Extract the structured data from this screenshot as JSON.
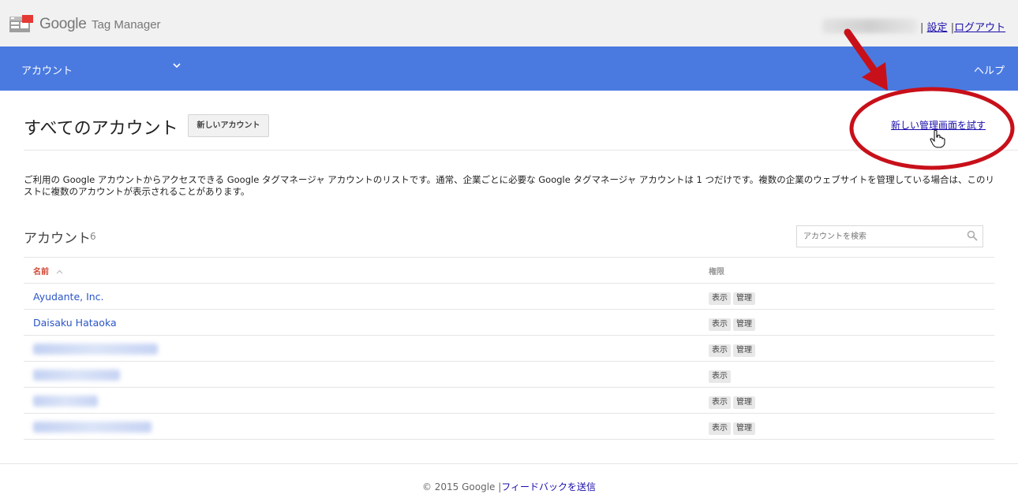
{
  "header": {
    "brand": "Google",
    "product": "Tag Manager",
    "separator": "|",
    "settings_link": "設定",
    "logout_link": "ログアウト"
  },
  "nav": {
    "account_label": "アカウント",
    "help_label": "ヘルプ"
  },
  "page": {
    "title": "すべてのアカウント",
    "new_account_button": "新しいアカウント",
    "try_new_ui_link": "新しい管理画面を試す",
    "description": "ご利用の Google アカウントからアクセスできる Google タグマネージャ アカウントのリストです。通常、企業ごとに必要な Google タグマネージャ アカウントは 1 つだけです。複数の企業のウェブサイトを管理している場合は、このリストに複数のアカウントが表示されることがあります。"
  },
  "accounts": {
    "section_title": "アカウント",
    "count": "6",
    "search_placeholder": "アカウントを検索",
    "columns": {
      "name": "名前",
      "permissions": "権限"
    },
    "rows": [
      {
        "name": "Ayudante, Inc.",
        "perms": [
          "表示",
          "管理"
        ]
      },
      {
        "name": "Daisaku Hataoka",
        "perms": [
          "表示",
          "管理"
        ]
      },
      {
        "name": "",
        "perms": [
          "表示",
          "管理"
        ]
      },
      {
        "name": "",
        "perms": [
          "表示"
        ]
      },
      {
        "name": "",
        "perms": [
          "表示",
          "管理"
        ]
      },
      {
        "name": "",
        "perms": [
          "表示",
          "管理"
        ]
      }
    ]
  },
  "footer": {
    "copyright": "© 2015 Google",
    "separator": "|",
    "feedback_link": "フィードバックを送信"
  },
  "colors": {
    "nav_blue": "#4a7ae0",
    "link_blue": "#1a0dab",
    "annotation_red": "#c8101a",
    "sort_red": "#d14836"
  }
}
